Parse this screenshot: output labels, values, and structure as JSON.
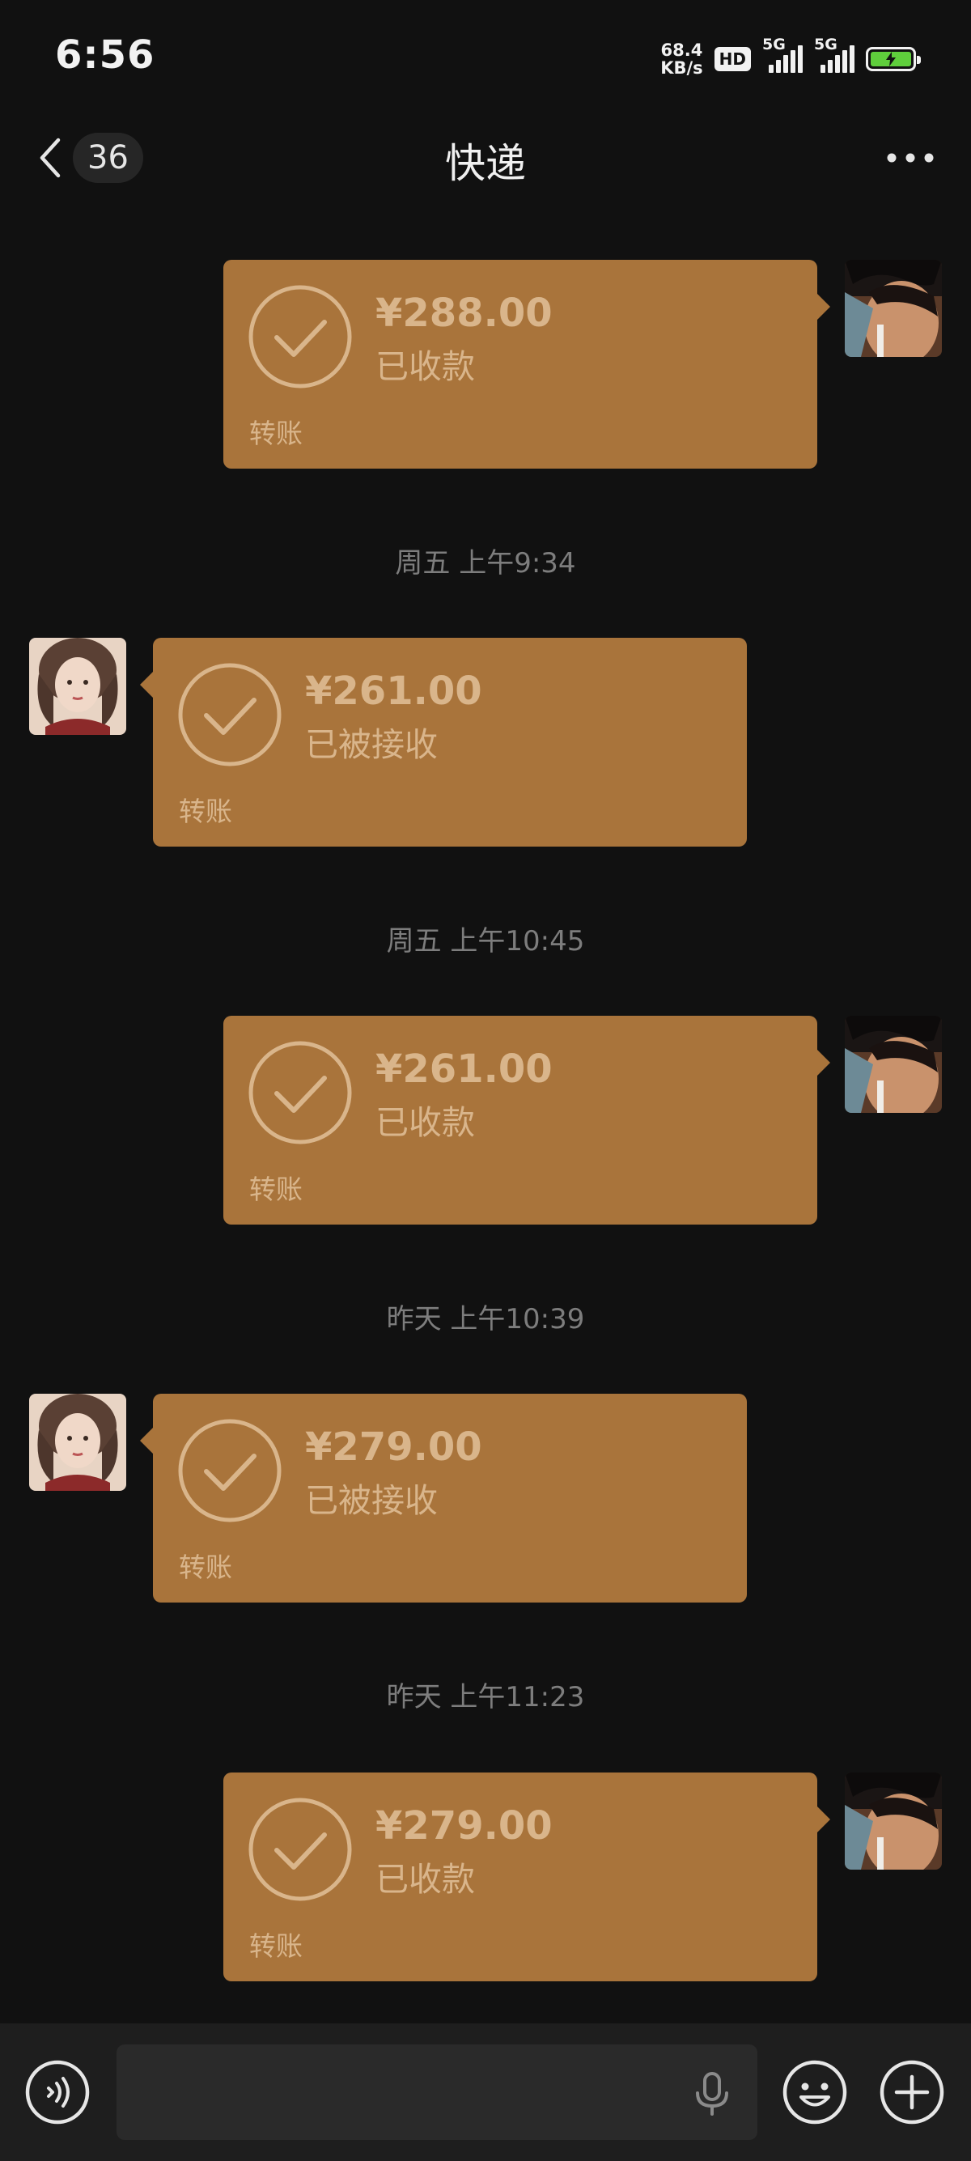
{
  "status_bar": {
    "time": "6:56",
    "net_speed_value": "68.4",
    "net_speed_unit": "KB/s",
    "hd_badge": "HD",
    "sim1_network": "5G",
    "sim2_network": "5G",
    "battery_charging": true,
    "battery_color": "#5fce3c"
  },
  "nav": {
    "back_count": "36",
    "title": "快递"
  },
  "colors": {
    "bubble": "#a9743b",
    "bubble_text": "#d9b58b",
    "background": "#111111",
    "timestamp": "#7d7d7d"
  },
  "messages": [
    {
      "side": "outgoing",
      "amount": "¥288.00",
      "status": "已收款",
      "label": "转账"
    },
    {
      "timestamp": "周五 上午9:34"
    },
    {
      "side": "incoming",
      "amount": "¥261.00",
      "status": "已被接收",
      "label": "转账"
    },
    {
      "timestamp": "周五 上午10:45"
    },
    {
      "side": "outgoing",
      "amount": "¥261.00",
      "status": "已收款",
      "label": "转账"
    },
    {
      "timestamp": "昨天 上午10:39"
    },
    {
      "side": "incoming",
      "amount": "¥279.00",
      "status": "已被接收",
      "label": "转账"
    },
    {
      "timestamp": "昨天 上午11:23"
    },
    {
      "side": "outgoing",
      "amount": "¥279.00",
      "status": "已收款",
      "label": "转账"
    }
  ],
  "input_bar": {
    "voice_icon": "voice-icon",
    "text_value": "",
    "mic_icon": "mic-icon",
    "emoji_icon": "emoji-icon",
    "plus_icon": "plus-icon"
  }
}
